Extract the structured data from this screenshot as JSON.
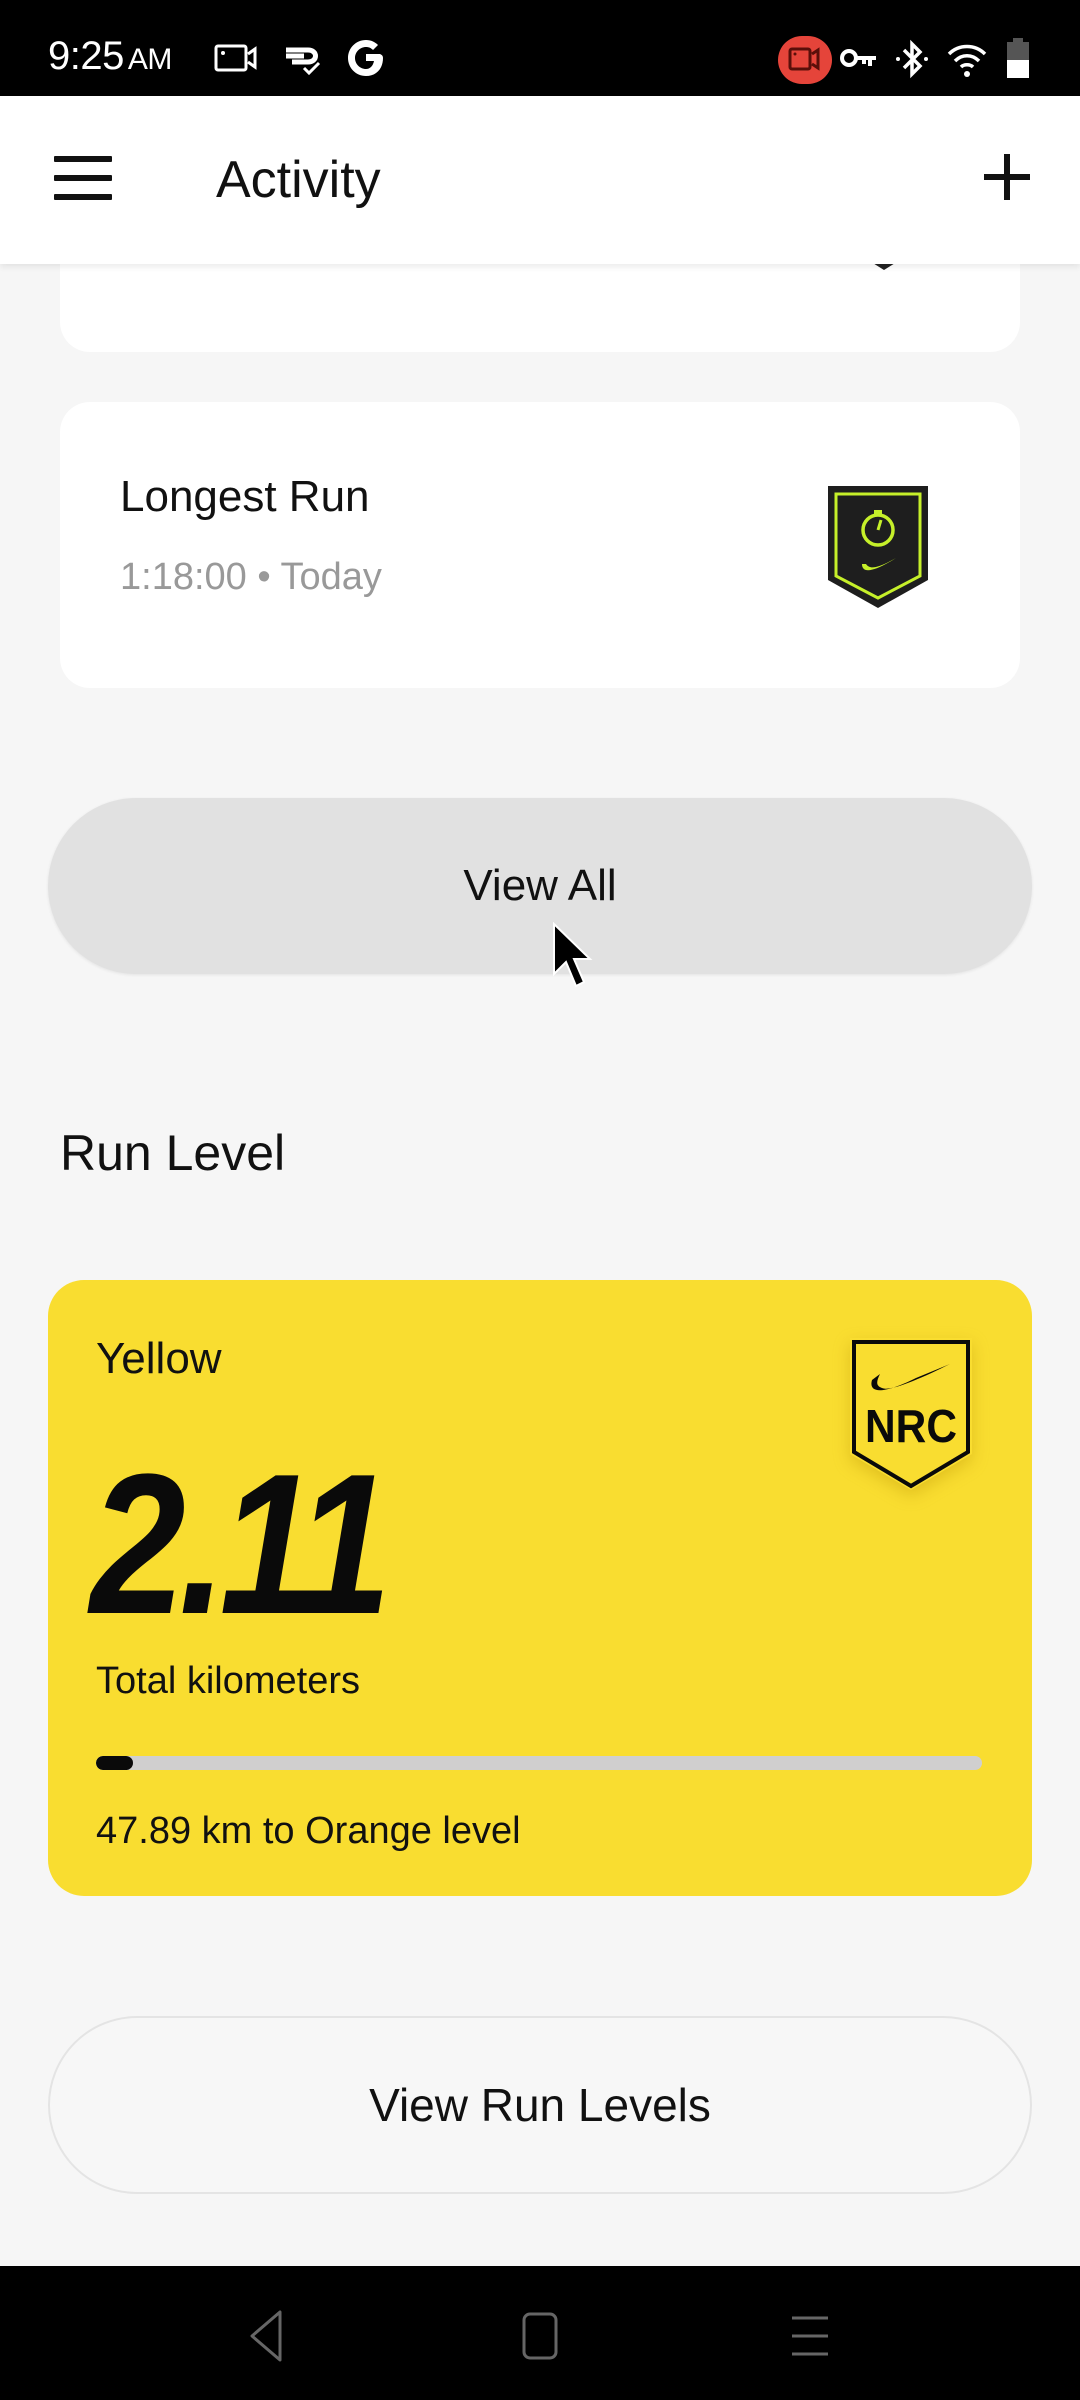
{
  "status_bar": {
    "time": "9:25",
    "ampm": "AM",
    "left_icons": [
      "screen-record-icon",
      "sync-check-icon",
      "google-icon"
    ],
    "right_icons": [
      "recording-active-icon",
      "vpn-key-icon",
      "bluetooth-icon",
      "wifi-icon",
      "battery-icon"
    ],
    "recording_color": "#e5443a"
  },
  "app_bar": {
    "title": "Activity",
    "menu_icon": "hamburger-menu-icon",
    "add_icon": "plus-icon"
  },
  "achievements": [
    {
      "title": "Longest Run",
      "value": "1:18:00",
      "separator": "•",
      "date": "Today",
      "subtitle": "1:18:00 • Today",
      "badge_icon": "stopwatch-badge-icon",
      "badge_colors": {
        "bg": "#1e1e1e",
        "accent": "#c6f02a"
      }
    }
  ],
  "view_all_button": {
    "label": "View All"
  },
  "run_level": {
    "section_title": "Run Level",
    "level_name": "Yellow",
    "total_km": "2.11",
    "total_label": "Total kilometers",
    "progress_fraction": 0.0422,
    "remaining_text": "47.89 km to Orange level",
    "badge_text": "NRC",
    "card_color": "#f9dd30"
  },
  "view_run_levels_button": {
    "label": "View Run Levels"
  },
  "nav_bar": {
    "buttons": [
      "back-icon",
      "home-icon",
      "recents-icon"
    ]
  }
}
